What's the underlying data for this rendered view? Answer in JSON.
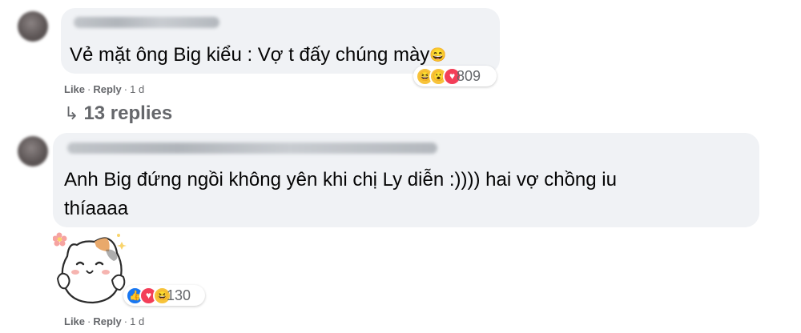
{
  "comments": [
    {
      "text": "Vẻ mặt ông Big kiểu : Vợ t đấy chúng mày",
      "emoji": "😄",
      "reaction_icons": [
        "haha-icon",
        "wow-icon",
        "love-icon"
      ],
      "reaction_count": "809",
      "like_label": "Like",
      "reply_label": "Reply",
      "time": "1 d",
      "replies_label": "13 replies"
    },
    {
      "text_line1": "Anh Big đứng ngồi không yên khi chị Ly diễn :)))) hai vợ chồng iu",
      "text_line2": "thíaaaa",
      "attachment": "cat-sticker",
      "reaction_icons": [
        "like-icon",
        "love-icon",
        "haha-icon"
      ],
      "reaction_count": "130",
      "like_label": "Like",
      "reply_label": "Reply",
      "time": "1 d"
    }
  ],
  "colors": {
    "bubble_bg": "#f0f2f5",
    "meta_text": "#65676b",
    "like_blue": "#1877f2",
    "love_red": "#f33e58",
    "haha_yellow": "#f7c33a"
  }
}
